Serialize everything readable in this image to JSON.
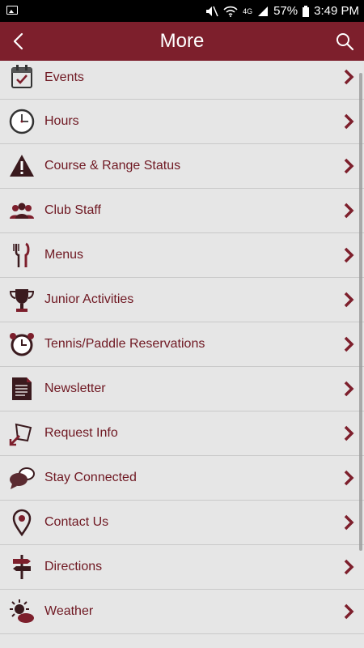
{
  "status_bar": {
    "battery": "57%",
    "time": "3:49 PM",
    "network": "4G"
  },
  "header": {
    "title": "More"
  },
  "icons": {
    "back": "back-arrow-icon",
    "search": "search-icon"
  },
  "colors": {
    "brand": "#7d1f2c",
    "text": "#6f1822",
    "background": "#e6e6e6"
  },
  "menu": [
    {
      "label": "Events",
      "icon": "calendar-icon"
    },
    {
      "label": "Hours",
      "icon": "clock-icon"
    },
    {
      "label": "Course & Range Status",
      "icon": "warning-icon"
    },
    {
      "label": "Club Staff",
      "icon": "people-icon"
    },
    {
      "label": "Menus",
      "icon": "fork-knife-icon"
    },
    {
      "label": "Junior Activities",
      "icon": "trophy-icon"
    },
    {
      "label": "Tennis/Paddle Reservations",
      "icon": "alarm-clock-icon"
    },
    {
      "label": "Newsletter",
      "icon": "document-icon"
    },
    {
      "label": "Request Info",
      "icon": "request-form-icon"
    },
    {
      "label": "Stay Connected",
      "icon": "chat-bubbles-icon"
    },
    {
      "label": "Contact Us",
      "icon": "location-pin-icon"
    },
    {
      "label": "Directions",
      "icon": "signpost-icon"
    },
    {
      "label": "Weather",
      "icon": "sun-cloud-icon"
    }
  ]
}
